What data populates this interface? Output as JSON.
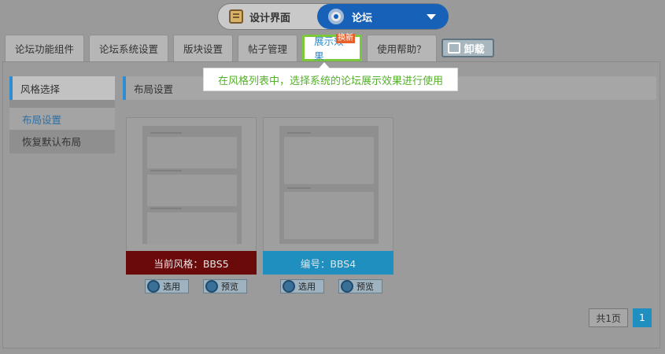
{
  "mode_switch": {
    "design_label": "设计界面",
    "forum_label": "论坛"
  },
  "tabs": [
    {
      "label": "论坛功能组件"
    },
    {
      "label": "论坛系统设置"
    },
    {
      "label": "版块设置"
    },
    {
      "label": "帖子管理"
    },
    {
      "label": "展示效果",
      "badge": "换新",
      "active": true
    },
    {
      "label": "使用帮助？"
    }
  ],
  "uninstall_label": "卸载",
  "tooltip_text": "在风格列表中，选择系统的论坛展示效果进行使用",
  "sidebar": {
    "title": "风格选择",
    "items": [
      {
        "label": "布局设置",
        "active": true
      },
      {
        "label": "恢复默认布局"
      }
    ]
  },
  "main": {
    "title": "布局设置",
    "cards": [
      {
        "label": "当前风格：BBS5",
        "select_label": "选用",
        "preview_label": "预览"
      },
      {
        "label": "编号：BBS4",
        "select_label": "选用",
        "preview_label": "预览"
      }
    ]
  },
  "pager": {
    "total_label": "共1页",
    "current_page": "1"
  },
  "colors": {
    "accent": "#2f8ed0",
    "tab_highlight": "#7bc83a",
    "current_style": "#6b0a0a",
    "other_style": "#1e8fbf",
    "tip_text": "#54b12a"
  }
}
